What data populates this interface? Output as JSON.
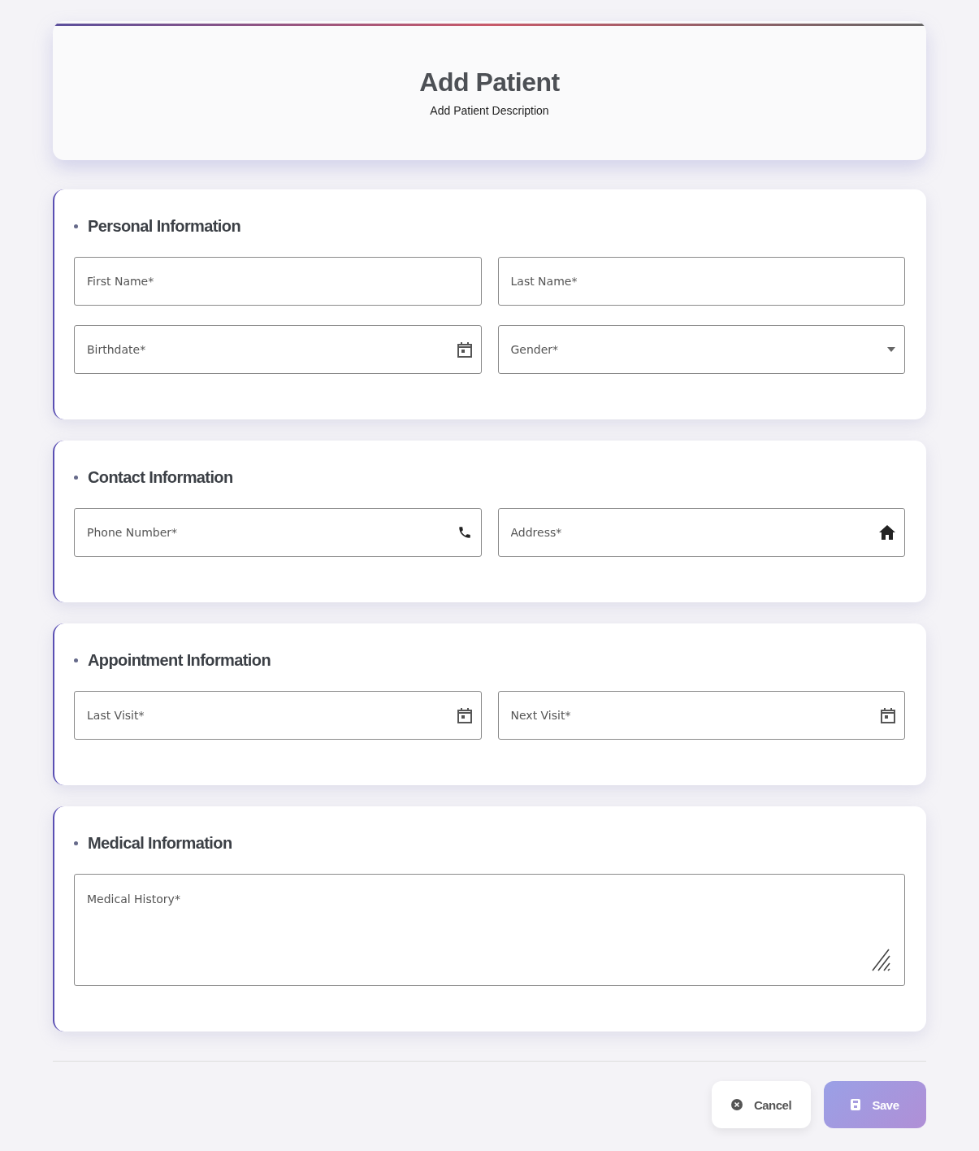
{
  "header": {
    "title": "Add Patient",
    "description": "Add Patient Description"
  },
  "sections": [
    {
      "title": "Personal Information",
      "fields": [
        {
          "kind": "text",
          "placeholder": "First Name*"
        },
        {
          "kind": "text",
          "placeholder": "Last Name*"
        },
        {
          "kind": "date",
          "placeholder": "Birthdate*"
        },
        {
          "kind": "select",
          "placeholder": "Gender*"
        }
      ]
    },
    {
      "title": "Contact Information",
      "fields": [
        {
          "kind": "phone",
          "placeholder": "Phone Number*"
        },
        {
          "kind": "address",
          "placeholder": "Address*"
        }
      ]
    },
    {
      "title": "Appointment Information",
      "fields": [
        {
          "kind": "date",
          "placeholder": "Last Visit*"
        },
        {
          "kind": "date",
          "placeholder": "Next Visit*"
        }
      ]
    },
    {
      "title": "Medical Information",
      "fields": [
        {
          "kind": "textarea",
          "placeholder": "Medical History*"
        }
      ]
    }
  ],
  "buttons": {
    "cancel": "Cancel",
    "save": "Save"
  }
}
